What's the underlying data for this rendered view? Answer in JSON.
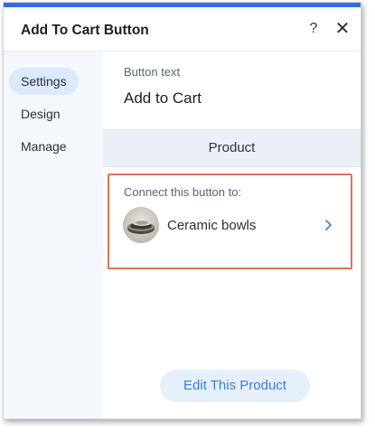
{
  "panel": {
    "title": "Add To Cart Button",
    "help_label": "?",
    "close_label": "✕"
  },
  "sidebar": {
    "items": [
      {
        "label": "Settings",
        "active": true
      },
      {
        "label": "Design",
        "active": false
      },
      {
        "label": "Manage",
        "active": false
      }
    ]
  },
  "settings": {
    "button_text_label": "Button text",
    "button_text_value": "Add to Cart",
    "section_title": "Product",
    "connect_label": "Connect this button to:",
    "product_name": "Ceramic bowls",
    "edit_button_label": "Edit This Product"
  },
  "colors": {
    "accent": "#2f6fe5",
    "highlight_border": "#e8705a",
    "sidebar_bg": "#f4f8fd",
    "active_nav_bg": "#dbe9fb",
    "section_bg": "#eaf0f6",
    "edit_button_bg": "#e6f0fb",
    "edit_button_text": "#3b7ddb"
  },
  "icons": {
    "help": "question-mark",
    "close": "close-x",
    "chevron": "chevron-right",
    "product_thumbnail": "ceramic-bowl-image"
  }
}
